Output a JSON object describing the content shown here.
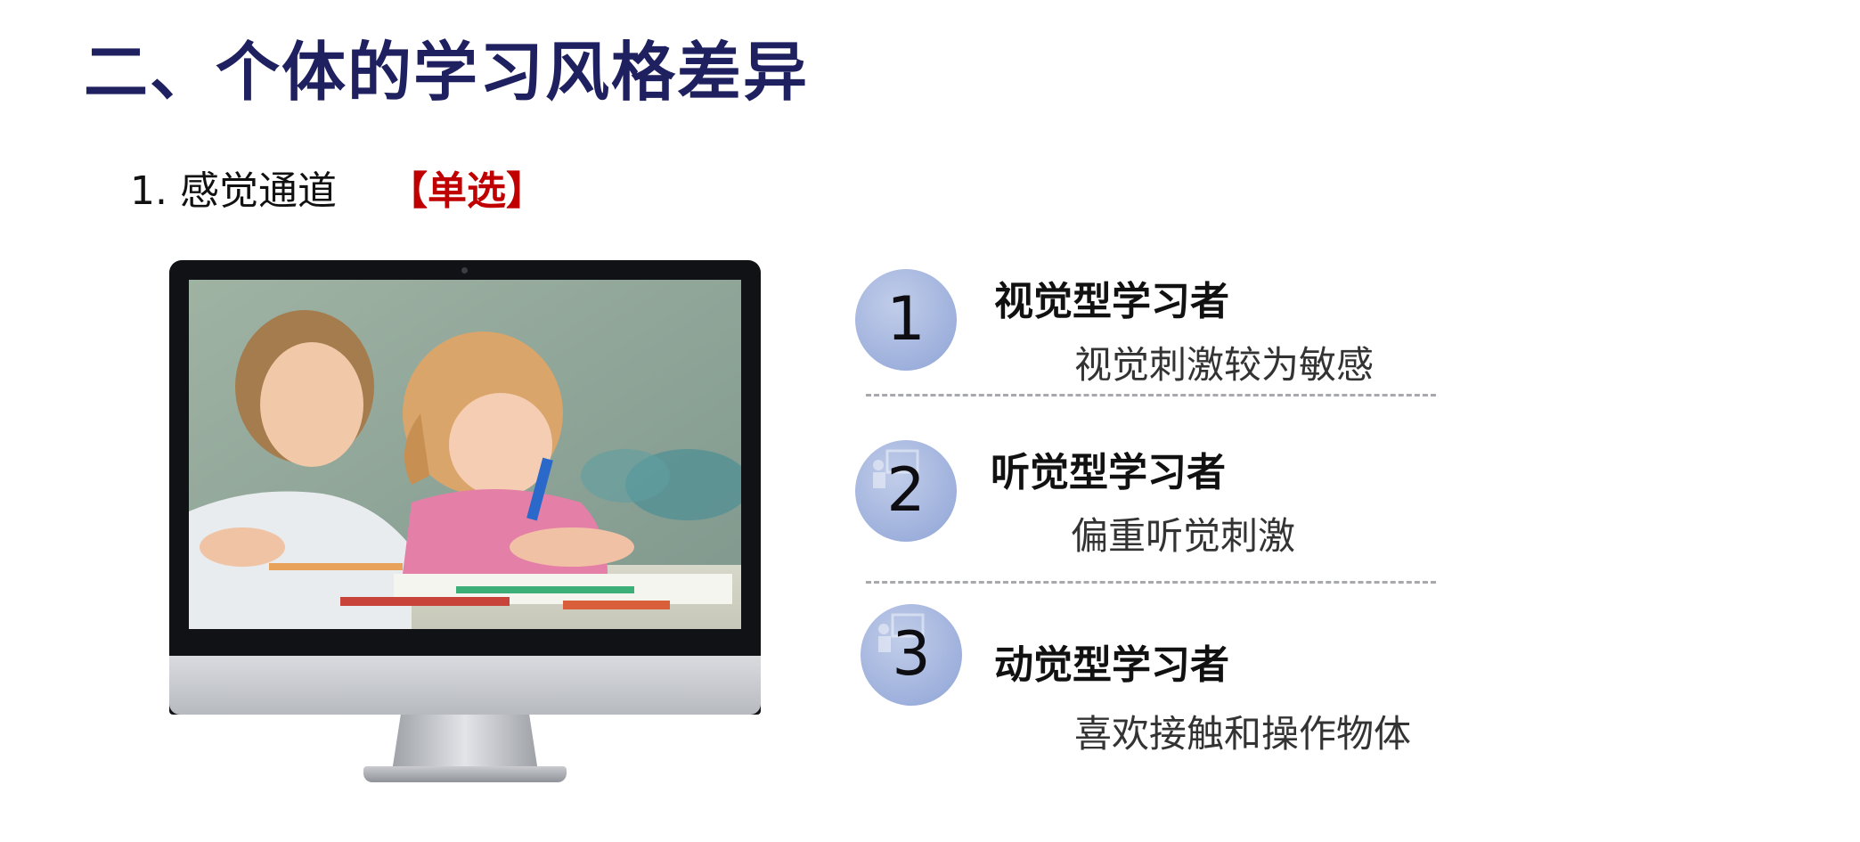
{
  "slide": {
    "title": "二、个体的学习风格差异",
    "subtitle": {
      "text": "1. 感觉通道",
      "tag": "【单选】"
    },
    "items": [
      {
        "number": "1",
        "heading": "视觉型学习者",
        "description": "视觉刺激较为敏感"
      },
      {
        "number": "2",
        "heading": "听觉型学习者",
        "description": "偏重听觉刺激"
      },
      {
        "number": "3",
        "heading": "动觉型学习者",
        "description": "喜欢接触和操作物体"
      }
    ]
  },
  "colors": {
    "title": "#1f2060",
    "tag": "#c00000",
    "circle": "#a3b3dc"
  }
}
